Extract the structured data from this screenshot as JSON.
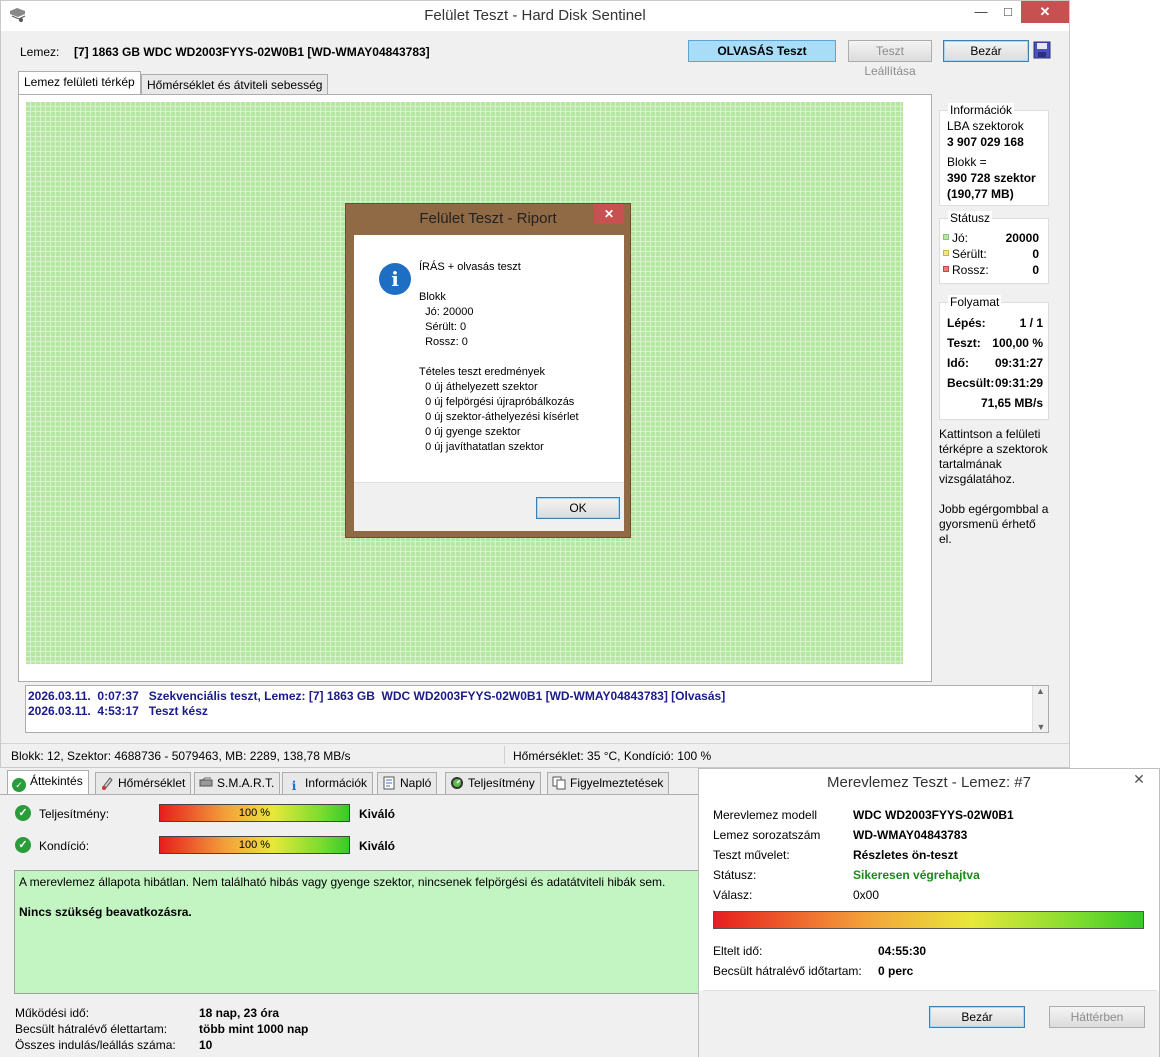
{
  "surface_window": {
    "title": "Felület Teszt - Hard Disk Sentinel",
    "disk_label": "Lemez:",
    "disk_value": "[7] 1863 GB  WDC WD2003FYYS-02W0B1 [WD-WMAY04843783]",
    "read_test_button": "OLVASÁS Teszt",
    "stop_button": "Teszt Leállítása",
    "close_button": "Bezár",
    "tabs": [
      "Lemez felületi térkép",
      "Hőmérséklet és átviteli sebesség"
    ],
    "info": {
      "title": "Információk",
      "lba_label": "LBA szektorok",
      "lba_value": "3 907 029 168",
      "block_label": "Blokk =",
      "block_value_1": "390 728 szektor",
      "block_value_2": "(190,77 MB)"
    },
    "status": {
      "title": "Státusz",
      "good_label": "Jó:",
      "good_value": "20000",
      "damaged_label": "Sérült:",
      "damaged_value": "0",
      "bad_label": "Rossz:",
      "bad_value": "0",
      "good_color": "#b6e6a4",
      "damaged_color": "#f2e48a",
      "bad_color": "#f07b7b"
    },
    "progress": {
      "title": "Folyamat",
      "step_label": "Lépés:",
      "step_value": "1 / 1",
      "test_label": "Teszt:",
      "test_value": "100,00 %",
      "time_label": "Idő:",
      "time_value": "09:31:27",
      "estimated_label": "Becsült:",
      "estimated_value": "09:31:29",
      "speed_value": "71,65 MB/s"
    },
    "hint_1": [
      "Kattintson a felületi",
      "térképre a szektorok",
      "tartalmának",
      "vizsgálatához."
    ],
    "hint_2": [
      "Jobb egérgombbal a",
      "gyorsmenü érhető",
      "el."
    ],
    "log": [
      "2026.03.11.  0:07:37   Szekvenciális teszt, Lemez: [7] 1863 GB  WDC WD2003FYYS-02W0B1 [WD-WMAY04843783] [Olvasás]",
      "2026.03.11.  4:53:17   Teszt kész"
    ],
    "statusbar_left": "Blokk: 12, Szektor: 4688736 - 5079463, MB: 2289, 138,78 MB/s",
    "statusbar_right": "Hőmérséklet: 35  °C,  Kondíció: 100 %",
    "map_color": "#b6e6a4"
  },
  "report_dialog": {
    "title": "Felület Teszt - Riport",
    "lines": [
      "ÍRÁS + olvasás teszt",
      "",
      "Blokk",
      "  Jó: 20000",
      "  Sérült: 0",
      "  Rossz: 0",
      "",
      "Tételes teszt eredmények",
      "  0 új áthelyezett szektor",
      "  0 új felpörgési újrapróbálkozás",
      "  0 új szektor-áthelyezési kísérlet",
      "  0 új gyenge szektor",
      "  0 új javíthatatlan szektor"
    ],
    "ok_button": "OK"
  },
  "main_app": {
    "tabs": [
      "Áttekintés",
      "Hőmérséklet",
      "S.M.A.R.T.",
      "Információk",
      "Napló",
      "Teljesítmény",
      "Figyelmeztetések"
    ],
    "performance_label": "Teljesítmény:",
    "performance_value": "100 %",
    "performance_percent": 100,
    "performance_rating": "Kiváló",
    "condition_label": "Kondíció:",
    "condition_value": "100 %",
    "condition_percent": 100,
    "condition_rating": "Kiváló",
    "message": "A merevlemez állapota hibátlan. Nem található hibás vagy gyenge szektor, nincsenek felpörgési és adatátviteli hibák sem.",
    "message_bold": "Nincs szükség beavatkozásra.",
    "uptime_label": "Működési idő:",
    "uptime_value": "18 nap, 23 óra",
    "remaining_life_label": "Becsült hátralévő élettartam:",
    "remaining_life_value": "több mint 1000 nap",
    "start_stop_label": "Összes indulás/leállás száma:",
    "start_stop_value": "10",
    "message_color": "#c3f5c3"
  },
  "disk_test_window": {
    "title": "Merevlemez Teszt - Lemez: #7",
    "model_label": "Merevlemez modell",
    "model_value": "WDC WD2003FYYS-02W0B1",
    "serial_label": "Lemez sorozatszám",
    "serial_value": "WD-WMAY04843783",
    "operation_label": "Teszt művelet:",
    "operation_value": "Részletes ön-teszt",
    "status_label": "Státusz:",
    "status_value": "Sikeresen végrehajtva",
    "response_label": "Válasz:",
    "response_value": "0x00",
    "elapsed_label": "Eltelt idő:",
    "elapsed_value": "04:55:30",
    "remaining_label": "Becsült hátralévő időtartam:",
    "remaining_value": "0 perc",
    "progress_percent": 100,
    "close_button": "Bezár",
    "background_button": "Háttérben",
    "status_color": "#1a8a1a"
  }
}
